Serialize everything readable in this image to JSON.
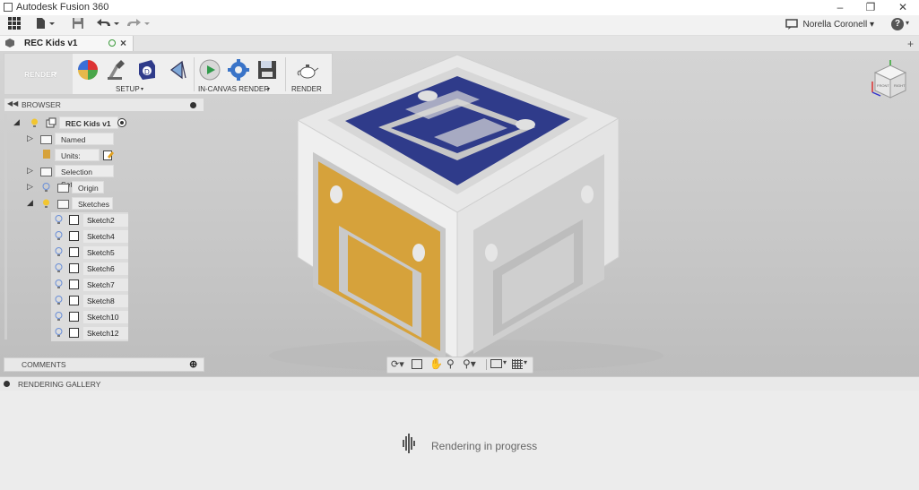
{
  "window": {
    "title": "Autodesk Fusion 360"
  },
  "toolbar": {
    "user": "Norella Coronell",
    "help": "?"
  },
  "document_tab": {
    "title": "REC Kids v1"
  },
  "workspace": {
    "label": "RENDER"
  },
  "ribbon": {
    "groups": [
      {
        "label": "SETUP"
      },
      {
        "label": "IN-CANVAS RENDER"
      },
      {
        "label": "RENDER"
      }
    ]
  },
  "browser": {
    "title": "BROWSER",
    "root": "REC Kids v1",
    "items": [
      {
        "label": "Named Views"
      },
      {
        "label": "Units: mm"
      },
      {
        "label": "Selection Sets"
      },
      {
        "label": "Origin"
      },
      {
        "label": "Sketches"
      }
    ],
    "sketches": [
      "Sketch2",
      "Sketch4",
      "Sketch5",
      "Sketch6",
      "Sketch7",
      "Sketch8",
      "Sketch10",
      "Sketch12"
    ]
  },
  "comments": {
    "title": "COMMENTS"
  },
  "viewcube": {
    "faces": [
      "FRONT",
      "RIGHT"
    ]
  },
  "gallery": {
    "title": "RENDERING GALLERY",
    "status": "Rendering in progress"
  },
  "colors": {
    "blue_face": "#2f3b8a",
    "orange_face": "#d9a23a",
    "body": "#ececec"
  }
}
